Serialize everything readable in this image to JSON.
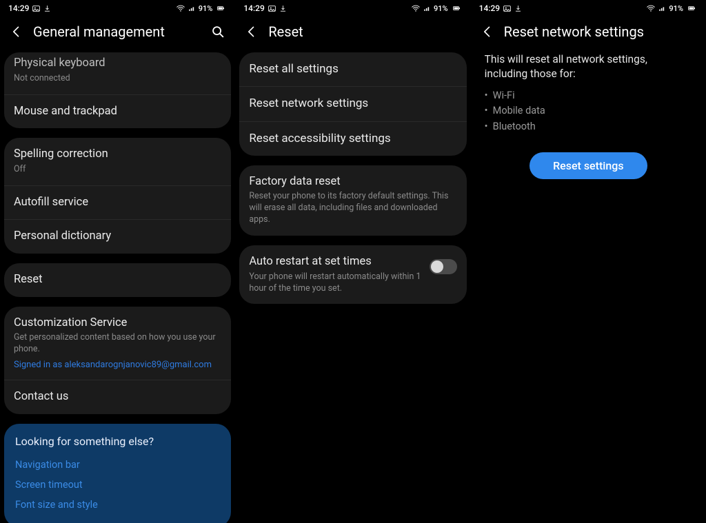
{
  "status": {
    "time": "14:29",
    "battery": "91%"
  },
  "screen1": {
    "title": "General management",
    "group1": [
      {
        "title": "Physical keyboard",
        "sub": "Not connected"
      },
      {
        "title": "Mouse and trackpad"
      }
    ],
    "group2": [
      {
        "title": "Spelling correction",
        "sub": "Off"
      },
      {
        "title": "Autofill service"
      },
      {
        "title": "Personal dictionary"
      }
    ],
    "group3": [
      {
        "title": "Reset"
      }
    ],
    "group4": [
      {
        "title": "Customization Service",
        "sub": "Get personalized content based on how you use your phone.",
        "link": "Signed in as aleksandarognjanovic89@gmail.com"
      },
      {
        "title": "Contact us"
      }
    ],
    "suggest": {
      "heading": "Looking for something else?",
      "links": [
        "Navigation bar",
        "Screen timeout",
        "Font size and style"
      ]
    }
  },
  "screen2": {
    "title": "Reset",
    "group1": [
      {
        "title": "Reset all settings"
      },
      {
        "title": "Reset network settings"
      },
      {
        "title": "Reset accessibility settings"
      }
    ],
    "group2": [
      {
        "title": "Factory data reset",
        "sub": "Reset your phone to its factory default settings. This will erase all data, including files and downloaded apps."
      }
    ],
    "group3": [
      {
        "title": "Auto restart at set times",
        "sub": "Your phone will restart automatically within 1 hour of the time you set.",
        "toggle": false
      }
    ]
  },
  "screen3": {
    "title": "Reset network settings",
    "description": "This will reset all network settings, including those for:",
    "bullets": [
      "Wi-Fi",
      "Mobile data",
      "Bluetooth"
    ],
    "button": "Reset settings"
  }
}
